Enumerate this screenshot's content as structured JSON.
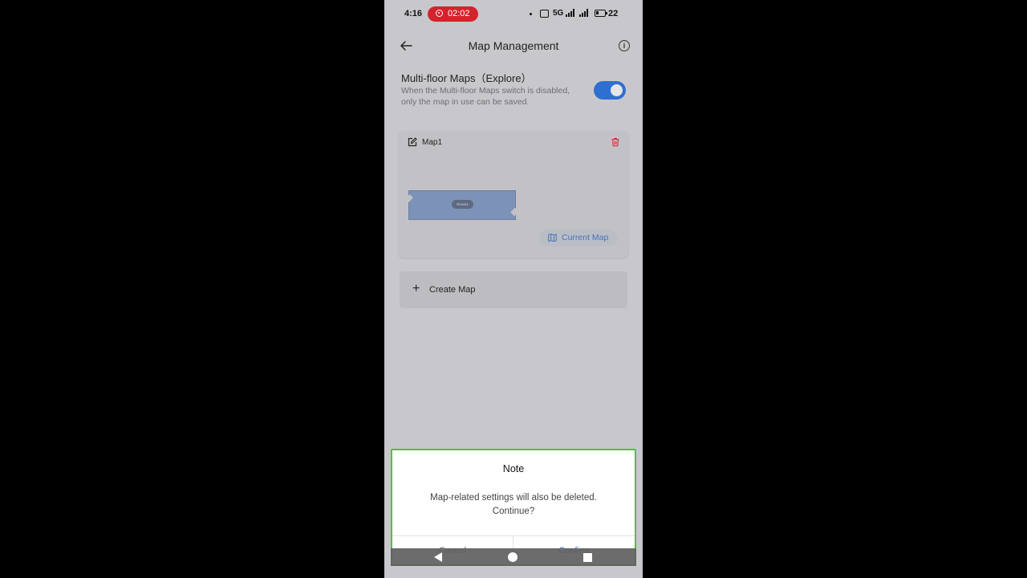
{
  "status_bar": {
    "time": "4:16",
    "recording_time": "02:02",
    "network": "5G",
    "battery": "22"
  },
  "header": {
    "back_icon": "arrow-left-icon",
    "title": "Map Management",
    "info_icon": "info-icon"
  },
  "multi_floor": {
    "title": "Multi-floor Maps（Explore）",
    "description": "When the Multi-floor Maps switch is disabled, only the map in use can be saved.",
    "enabled": true
  },
  "map_card": {
    "name": "Map1",
    "room_label": "Room1",
    "current_map_label": "Current Map"
  },
  "create_map": {
    "plus": "+",
    "label": "Create Map"
  },
  "dialog": {
    "title": "Note",
    "message": "Map-related settings will also be deleted. Continue?",
    "cancel_label": "Cancel",
    "confirm_label": "Confirm"
  },
  "colors": {
    "accent": "#2f6fd2",
    "delete": "#d4232c",
    "highlight": "#52c23a"
  }
}
